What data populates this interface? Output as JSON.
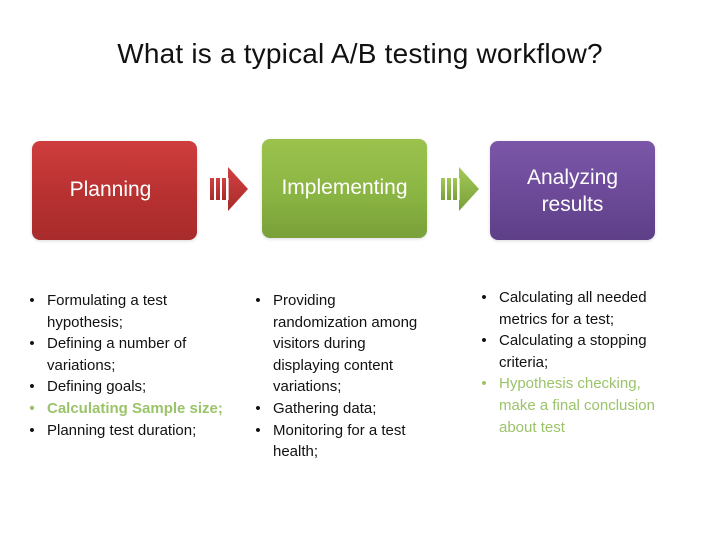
{
  "title": "What is a typical A/B testing workflow?",
  "colors": {
    "planning": "#b83131",
    "implementing": "#8bb543",
    "analyzing": "#6c4a98",
    "highlight_text": "#9bc36a",
    "body_text": "#111111"
  },
  "icons": {
    "arrow_1": "striped-right-arrow-icon",
    "arrow_2": "striped-right-arrow-icon"
  },
  "steps": [
    {
      "label": "Planning",
      "items": [
        {
          "text": "Formulating a test hypothesis;",
          "highlight": false
        },
        {
          "text": "Defining a number of variations;",
          "highlight": false
        },
        {
          "text": "Defining goals;",
          "highlight": false
        },
        {
          "text": "Calculating Sample size;",
          "highlight": true
        },
        {
          "text": "Planning test duration;",
          "highlight": false
        }
      ]
    },
    {
      "label": "Implementing",
      "items": [
        {
          "text": "Providing randomization among visitors during displaying content variations;",
          "highlight": false
        },
        {
          "text": "Gathering data;",
          "highlight": false
        },
        {
          "text": "Monitoring  for a test health;",
          "highlight": false
        }
      ]
    },
    {
      "label": "Analyzing results",
      "items": [
        {
          "text": "Calculating all needed metrics for a test;",
          "highlight": false
        },
        {
          "text": "Calculating a stopping criteria;",
          "highlight": false
        },
        {
          "text": "Hypothesis checking, make a final conclusion about test",
          "highlight": true
        }
      ]
    }
  ],
  "bullet_char": "•"
}
